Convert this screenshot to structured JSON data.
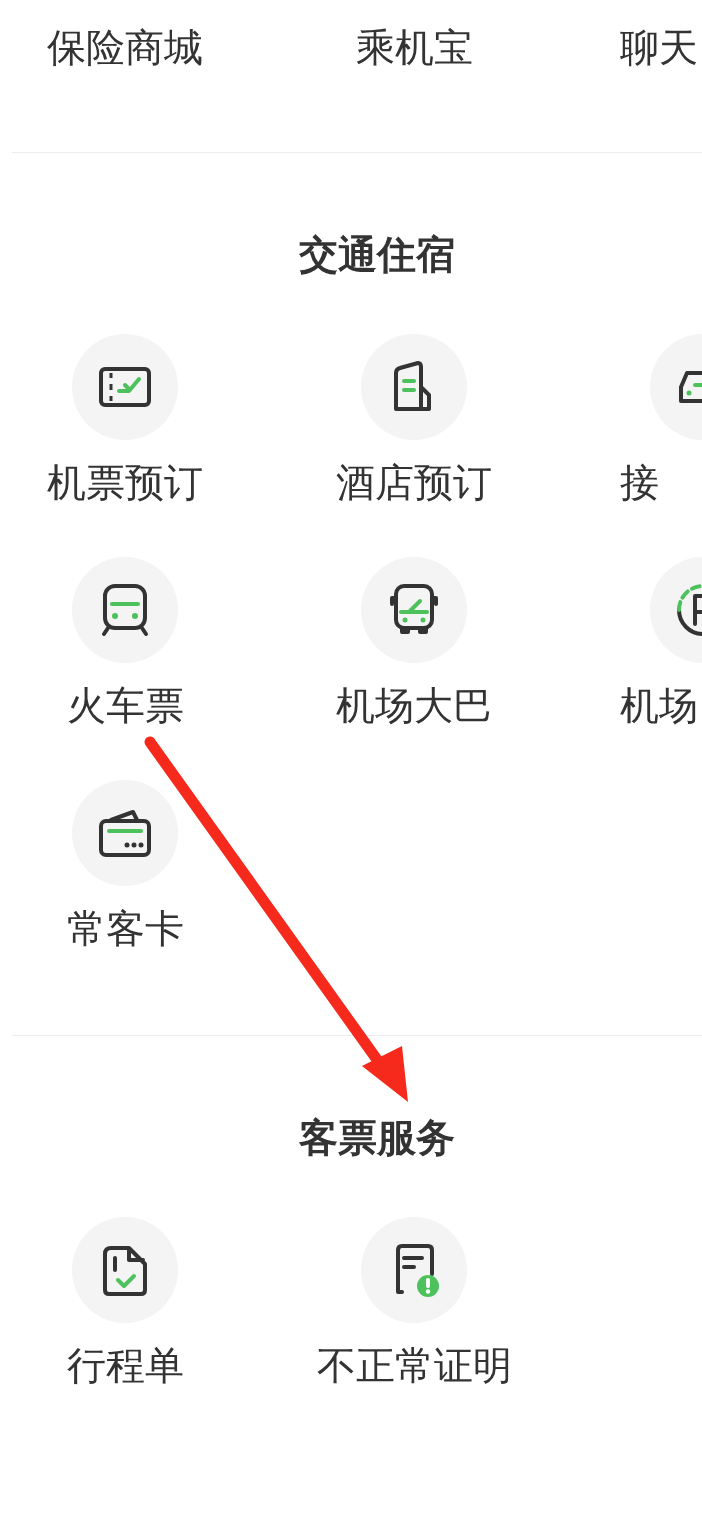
{
  "top_row": [
    {
      "label": "保险商城"
    },
    {
      "label": "乘机宝"
    },
    {
      "label": "聊天"
    }
  ],
  "sections": [
    {
      "title": "交通住宿",
      "items": [
        {
          "label": "机票预订"
        },
        {
          "label": "酒店预订"
        },
        {
          "label": "接"
        },
        {
          "label": "火车票"
        },
        {
          "label": "机场大巴"
        },
        {
          "label": "机场"
        },
        {
          "label": "常客卡"
        }
      ]
    },
    {
      "title": "客票服务",
      "items": [
        {
          "label": "行程单"
        },
        {
          "label": "不正常证明"
        }
      ]
    }
  ],
  "annotation": {
    "kind": "arrow"
  }
}
